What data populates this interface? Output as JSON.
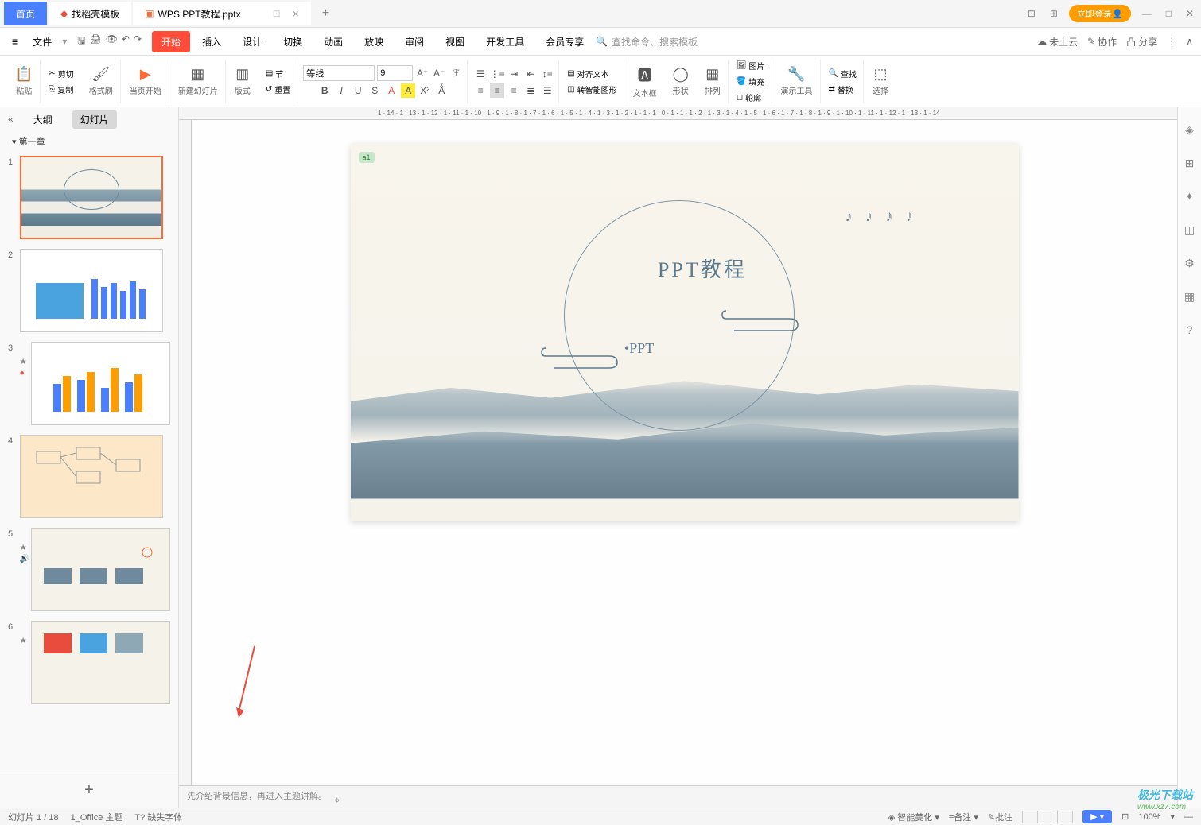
{
  "titlebar": {
    "home_tab": "首页",
    "template_tab": "找稻壳模板",
    "file_tab": "WPS PPT教程.pptx",
    "login": "立即登录"
  },
  "menubar": {
    "file": "文件",
    "items": [
      "开始",
      "插入",
      "设计",
      "切换",
      "动画",
      "放映",
      "审阅",
      "视图",
      "开发工具",
      "会员专享"
    ],
    "search_placeholder": "查找命令、搜索模板",
    "cloud": "未上云",
    "collab": "协作",
    "share": "分享"
  },
  "ribbon": {
    "paste": "粘贴",
    "cut": "剪切",
    "copy": "复制",
    "format_painter": "格式刷",
    "slide_from": "当页开始",
    "new_slide": "新建幻灯片",
    "layout": "版式",
    "section": "节",
    "reset": "重置",
    "font_name": "等线",
    "font_size": "9",
    "align_text": "对齐文本",
    "smart_art": "转智能图形",
    "text_box": "文本框",
    "shape": "形状",
    "arrange": "排列",
    "picture": "图片",
    "fill": "填充",
    "outline": "轮廓",
    "tools": "演示工具",
    "find": "查找",
    "replace": "替换",
    "select": "选择"
  },
  "sidepanel": {
    "outline": "大纲",
    "slides": "幻灯片",
    "chapter1": "第一章",
    "thumbs": [
      1,
      2,
      3,
      4,
      5,
      6
    ]
  },
  "slide": {
    "tag": "a1",
    "title": "PPT教程",
    "subtitle": "•PPT"
  },
  "notes": "先介绍背景信息，再进入主题讲解。",
  "statusbar": {
    "slide_info": "幻灯片 1 / 18",
    "theme": "1_Office 主题",
    "missing_font": "缺失字体",
    "beautify": "智能美化",
    "notes": "备注",
    "comments": "批注",
    "zoom": "100%"
  },
  "ruler": "1 · 14 · 1 · 13 · 1 · 12 · 1 · 11 · 1 · 10 · 1 · 9 · 1 · 8 · 1 · 7 · 1 · 6 · 1 · 5 · 1 · 4 · 1 · 3 · 1 · 2 · 1 · 1 · 1 · 0 · 1 · 1 · 1 · 2 · 1 · 3 · 1 · 4 · 1 · 5 · 1 · 6 · 1 · 7 · 1 · 8 · 1 · 9 · 1 · 10 · 1 · 11 · 1 · 12 · 1 · 13 · 1 · 14",
  "watermark": {
    "brand": "极光下载站",
    "url": "www.xz7.com"
  }
}
